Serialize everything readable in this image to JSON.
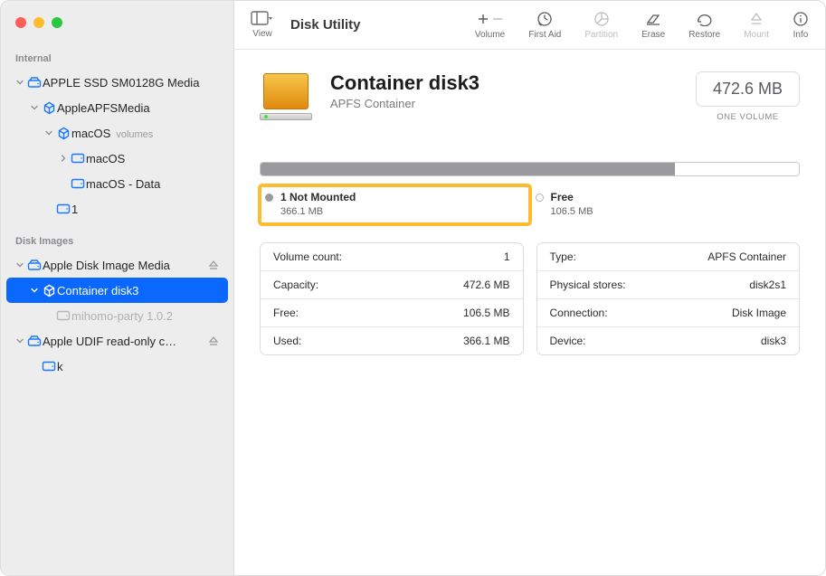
{
  "app_title": "Disk Utility",
  "toolbar": {
    "view_label": "View",
    "buttons": {
      "volume": "Volume",
      "first_aid": "First Aid",
      "partition": "Partition",
      "erase": "Erase",
      "restore": "Restore",
      "mount": "Mount",
      "info": "Info"
    }
  },
  "sidebar": {
    "sections": [
      {
        "title": "Internal",
        "items": [
          {
            "label": "APPLE SSD SM0128G Media",
            "indent": 0,
            "icon": "disk",
            "chev": "down"
          },
          {
            "label": "AppleAPFSMedia",
            "indent": 1,
            "icon": "container",
            "chev": "down"
          },
          {
            "label": "macOS",
            "sub": "volumes",
            "indent": 2,
            "icon": "container",
            "chev": "down"
          },
          {
            "label": "macOS",
            "indent": 3,
            "icon": "volume",
            "chev": "right"
          },
          {
            "label": "macOS - Data",
            "indent": 3,
            "icon": "volume",
            "chev": "none"
          },
          {
            "label": "1",
            "indent": 2,
            "icon": "volume",
            "chev": "none"
          }
        ]
      },
      {
        "title": "Disk Images",
        "items": [
          {
            "label": "Apple Disk Image Media",
            "indent": 0,
            "icon": "disk",
            "chev": "down",
            "eject": true
          },
          {
            "label": "Container disk3",
            "indent": 1,
            "icon": "container",
            "chev": "down",
            "selected": true
          },
          {
            "label": "mihomo-party 1.0.2",
            "indent": 2,
            "icon": "volume",
            "chev": "none",
            "dim": true
          },
          {
            "label": "Apple UDIF read-only c…",
            "indent": 0,
            "icon": "disk",
            "chev": "down",
            "eject": true
          },
          {
            "label": "k",
            "indent": 1,
            "icon": "volume",
            "chev": "none"
          }
        ]
      }
    ]
  },
  "detail": {
    "title": "Container disk3",
    "subtitle": "APFS Container",
    "size": "472.6 MB",
    "size_sub": "ONE VOLUME",
    "usage": {
      "used_pct": 77
    },
    "legend": [
      {
        "label": "1 Not Mounted",
        "value": "366.1 MB",
        "kind": "used",
        "highlighted": true
      },
      {
        "label": "Free",
        "value": "106.5 MB",
        "kind": "free"
      }
    ],
    "info_left": [
      {
        "key": "Volume count:",
        "val": "1"
      },
      {
        "key": "Capacity:",
        "val": "472.6 MB"
      },
      {
        "key": "Free:",
        "val": "106.5 MB"
      },
      {
        "key": "Used:",
        "val": "366.1 MB"
      }
    ],
    "info_right": [
      {
        "key": "Type:",
        "val": "APFS Container"
      },
      {
        "key": "Physical stores:",
        "val": "disk2s1"
      },
      {
        "key": "Connection:",
        "val": "Disk Image"
      },
      {
        "key": "Device:",
        "val": "disk3"
      }
    ]
  }
}
